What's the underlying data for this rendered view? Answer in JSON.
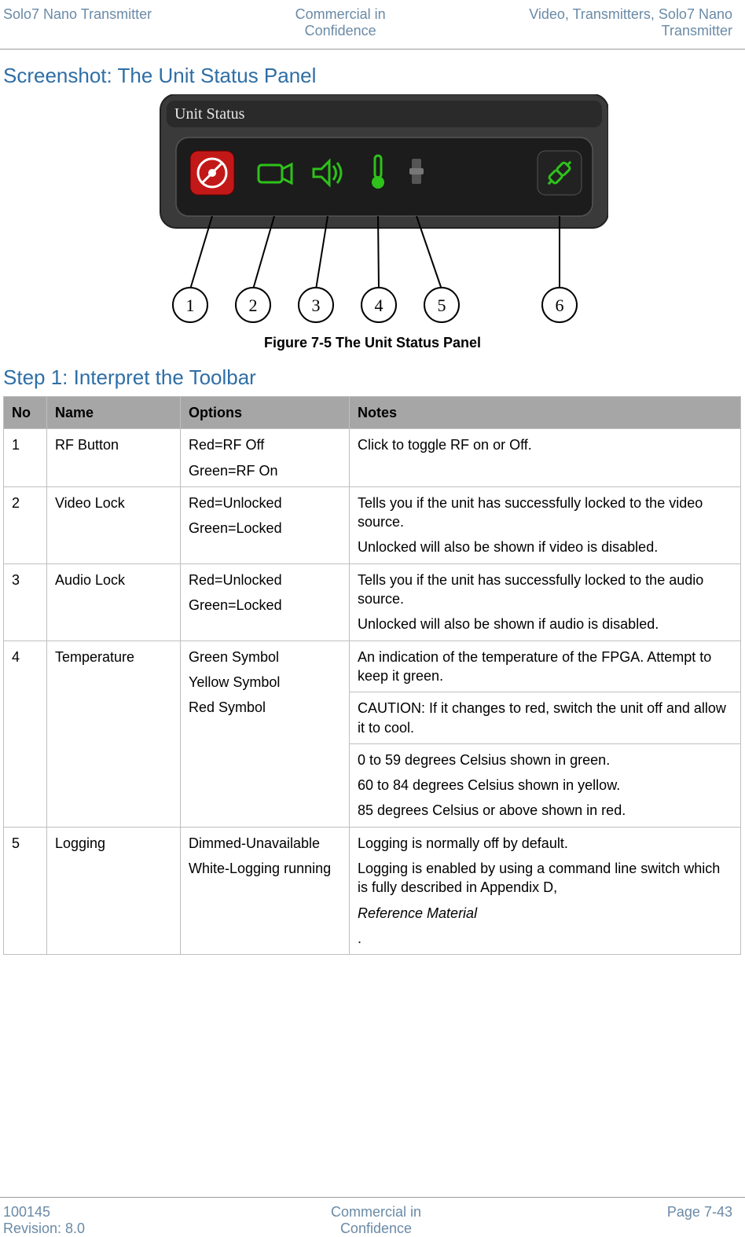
{
  "header": {
    "left": "Solo7 Nano Transmitter",
    "center_line1": "Commercial in",
    "center_line2": "Confidence",
    "right_line1": "Video, Transmitters, Solo7 Nano",
    "right_line2": "Transmitter"
  },
  "screenshot_title": "Screenshot: The Unit Status Panel",
  "panel": {
    "title": "Unit Status",
    "callouts": [
      "1",
      "2",
      "3",
      "4",
      "5",
      "6"
    ]
  },
  "figure_caption": "Figure 7-5 The Unit Status Panel",
  "step_title": "Step 1: Interpret the Toolbar",
  "table_headers": {
    "no": "No",
    "name": "Name",
    "options": "Options",
    "notes": "Notes"
  },
  "rows": {
    "r1": {
      "no": "1",
      "name": "RF Button",
      "opt1": "Red=RF Off",
      "opt2": "Green=RF On",
      "note1": "Click to toggle RF on or Off."
    },
    "r2": {
      "no": "2",
      "name": "Video Lock",
      "opt1": "Red=Unlocked",
      "opt2": "Green=Locked",
      "note1": "Tells you if the unit has successfully locked to the video source.",
      "note2": "Unlocked will also be shown if video is disabled."
    },
    "r3": {
      "no": "3",
      "name": "Audio Lock",
      "opt1": "Red=Unlocked",
      "opt2": "Green=Locked",
      "note1": "Tells you if the unit has successfully locked to the audio source.",
      "note2": "Unlocked will also be shown if audio is disabled."
    },
    "r4": {
      "no": "4",
      "name": "Temperature",
      "opt1": "Green Symbol",
      "opt2": "Yellow Symbol",
      "opt3": "Red Symbol",
      "noteA": "An indication of the temperature of the FPGA. Attempt to keep it green.",
      "noteB": "CAUTION: If it changes to red, switch the unit off and allow it to cool.",
      "noteC1": "0 to 59 degrees Celsius shown in green.",
      "noteC2": "60 to 84 degrees Celsius shown in yellow.",
      "noteC3": "85 degrees Celsius or above shown in red."
    },
    "r5": {
      "no": "5",
      "name": "Logging",
      "opt1": "Dimmed-Unavailable",
      "opt2": "White-Logging running",
      "note1": "Logging is normally off by default.",
      "note2a": "Logging is enabled by using a command line switch which is fully described in Appendix D, ",
      "note2b": "Reference Material",
      "note2c": "."
    }
  },
  "footer": {
    "left_line1": "100145",
    "left_line2": "Revision: 8.0",
    "center_line1": "Commercial in",
    "center_line2": "Confidence",
    "right": "Page 7-43"
  }
}
